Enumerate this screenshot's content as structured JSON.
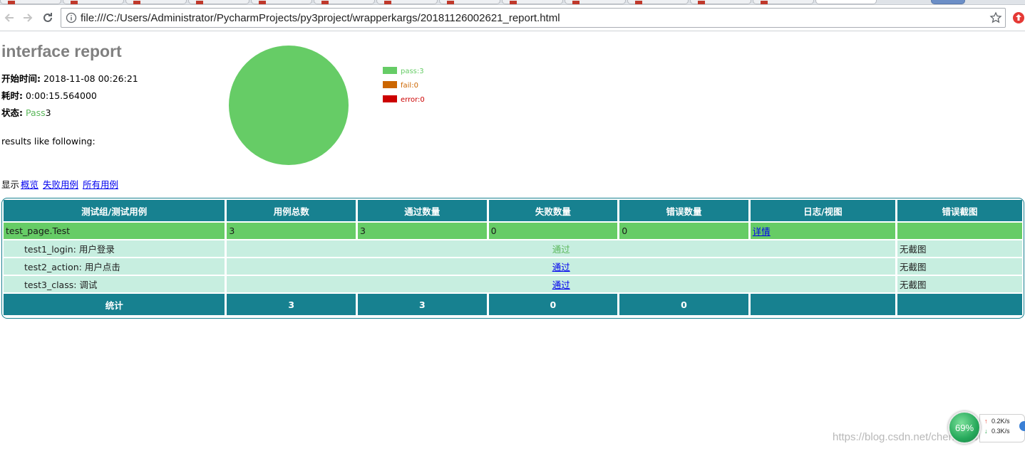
{
  "browser": {
    "url": "file:///C:/Users/Administrator/PycharmProjects/py3project/wrapperkargs/20181126002621_report.html"
  },
  "report": {
    "title": "interface report",
    "attributes": [
      {
        "key": "开始时间:",
        "value": "2018-11-08 00:26:21"
      },
      {
        "key": "耗时:",
        "value": "0:00:15.564000"
      },
      {
        "key": "状态:",
        "value_status": "Pass",
        "value_count": "3"
      }
    ],
    "description": "results like following:",
    "pie": {
      "legend": [
        {
          "label": "pass:3",
          "color": "#66cc66"
        },
        {
          "label": "fail:0",
          "color": "#cc6600"
        },
        {
          "label": "error:0",
          "color": "#cc0000"
        }
      ]
    },
    "filters": {
      "prefix": "显示",
      "links": [
        "概览",
        "失败用例",
        "所有用例"
      ]
    },
    "table": {
      "headers": [
        "测试组/测试用例",
        "用例总数",
        "通过数量",
        "失败数量",
        "错误数量",
        "日志/视图",
        "错误截图"
      ],
      "suite": {
        "name": "test_page.Test",
        "count": "3",
        "pass": "3",
        "fail": "0",
        "error": "0",
        "detail_link": "详情",
        "screenshot": ""
      },
      "cases": [
        {
          "name": "test1_login: 用户登录",
          "status": "通过",
          "screenshot": "无截图"
        },
        {
          "name": "test2_action: 用户点击",
          "status": "通过",
          "screenshot": "无截图"
        },
        {
          "name": "test3_class: 调试",
          "status": "通过",
          "screenshot": "无截图"
        }
      ],
      "total": {
        "label": "统计",
        "count": "3",
        "pass": "3",
        "fail": "0",
        "error": "0"
      }
    }
  },
  "chart_data": {
    "type": "pie",
    "categories": [
      "pass",
      "fail",
      "error"
    ],
    "values": [
      3,
      0,
      0
    ],
    "colors": [
      "#66cc66",
      "#cc6600",
      "#cc0000"
    ],
    "title": "",
    "legend_placement": "right"
  },
  "overlay": {
    "watermark": "https://blog.csdn.net/chen498868008",
    "gauge_percent": "69%",
    "upload_speed": "0.2K/s",
    "download_speed": "0.3K/s"
  }
}
